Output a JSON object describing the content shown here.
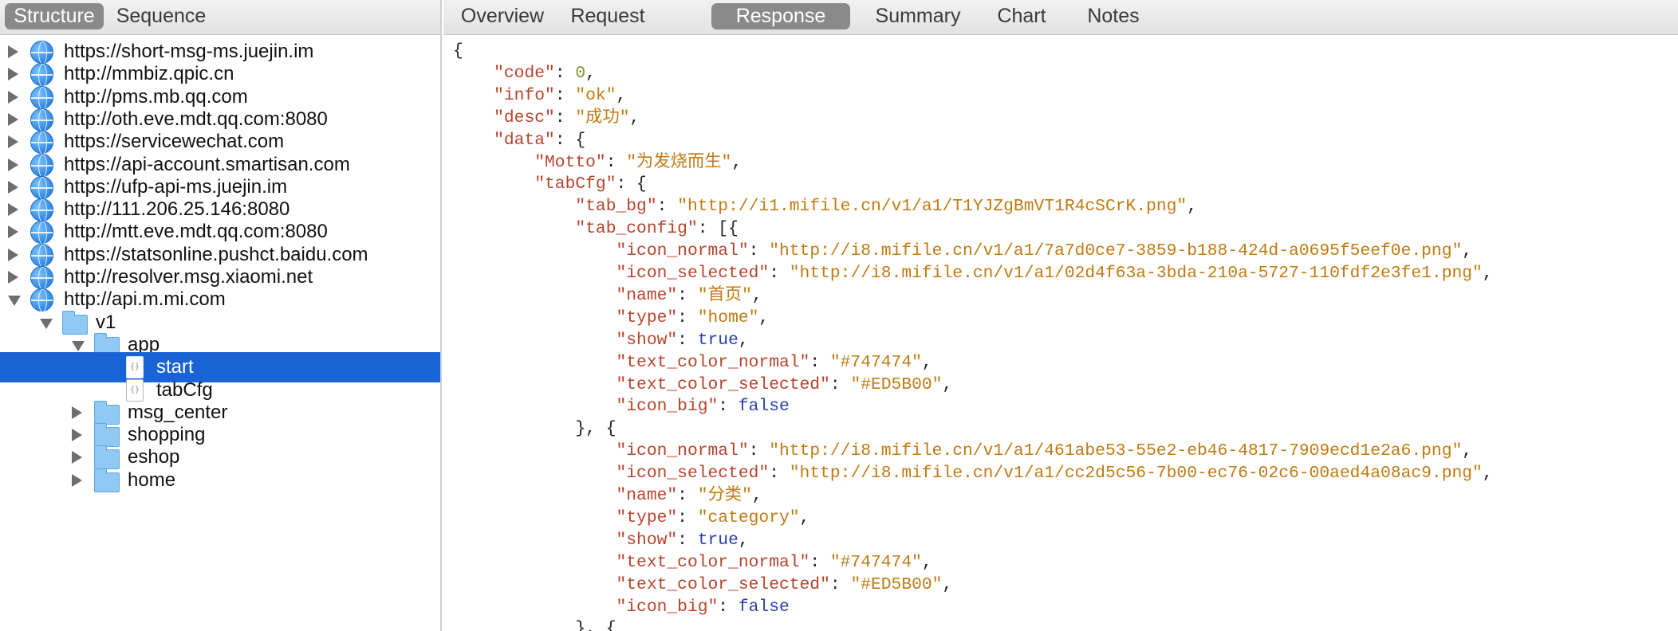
{
  "left_tabs": [
    {
      "label": "Structure",
      "active": true
    },
    {
      "label": "Sequence",
      "active": false
    }
  ],
  "right_tabs": [
    {
      "label": "Overview",
      "active": false
    },
    {
      "label": "Request",
      "active": false
    },
    {
      "label": "Response",
      "active": true
    },
    {
      "label": "Summary",
      "active": false
    },
    {
      "label": "Chart",
      "active": false
    },
    {
      "label": "Notes",
      "active": false
    }
  ],
  "tree": [
    {
      "label": "https://short-msg-ms.juejin.im",
      "icon": "globe-icon",
      "level": 0,
      "expanded": false
    },
    {
      "label": "http://mmbiz.qpic.cn",
      "icon": "globe-icon",
      "level": 0,
      "expanded": false
    },
    {
      "label": "http://pms.mb.qq.com",
      "icon": "globe-icon",
      "level": 0,
      "expanded": false
    },
    {
      "label": "http://oth.eve.mdt.qq.com:8080",
      "icon": "globe-icon",
      "level": 0,
      "expanded": false
    },
    {
      "label": "https://servicewechat.com",
      "icon": "globe-icon",
      "level": 0,
      "expanded": false
    },
    {
      "label": "https://api-account.smartisan.com",
      "icon": "globe-icon",
      "level": 0,
      "expanded": false
    },
    {
      "label": "https://ufp-api-ms.juejin.im",
      "icon": "globe-icon",
      "level": 0,
      "expanded": false
    },
    {
      "label": "http://111.206.25.146:8080",
      "icon": "globe-icon",
      "level": 0,
      "expanded": false
    },
    {
      "label": "http://mtt.eve.mdt.qq.com:8080",
      "icon": "globe-icon",
      "level": 0,
      "expanded": false
    },
    {
      "label": "https://statsonline.pushct.baidu.com",
      "icon": "globe-icon",
      "level": 0,
      "expanded": false
    },
    {
      "label": "http://resolver.msg.xiaomi.net",
      "icon": "globe-icon",
      "level": 0,
      "expanded": false
    },
    {
      "label": "http://api.m.mi.com",
      "icon": "globe-icon",
      "level": 0,
      "expanded": true
    },
    {
      "label": "v1",
      "icon": "folder-icon",
      "level": 1,
      "expanded": true
    },
    {
      "label": "app",
      "icon": "folder-icon",
      "level": 2,
      "expanded": true
    },
    {
      "label": "start",
      "icon": "json-file-icon",
      "level": 3,
      "leaf": true,
      "selected": true
    },
    {
      "label": "tabCfg",
      "icon": "json-file-icon",
      "level": 3,
      "leaf": true
    },
    {
      "label": "msg_center",
      "icon": "folder-icon",
      "level": 2,
      "expanded": false
    },
    {
      "label": "shopping",
      "icon": "folder-icon",
      "level": 2,
      "expanded": false
    },
    {
      "label": "eshop",
      "icon": "folder-icon",
      "level": 2,
      "expanded": false
    },
    {
      "label": "home",
      "icon": "folder-icon",
      "level": 2,
      "expanded": false
    }
  ],
  "response_lines": [
    [
      {
        "t": "p",
        "v": "{"
      }
    ],
    [
      {
        "t": "p",
        "v": "    "
      },
      {
        "t": "k",
        "v": "\"code\""
      },
      {
        "t": "p",
        "v": ": "
      },
      {
        "t": "n",
        "v": "0"
      },
      {
        "t": "p",
        "v": ","
      }
    ],
    [
      {
        "t": "p",
        "v": "    "
      },
      {
        "t": "k",
        "v": "\"info\""
      },
      {
        "t": "p",
        "v": ": "
      },
      {
        "t": "s",
        "v": "\"ok\""
      },
      {
        "t": "p",
        "v": ","
      }
    ],
    [
      {
        "t": "p",
        "v": "    "
      },
      {
        "t": "k",
        "v": "\"desc\""
      },
      {
        "t": "p",
        "v": ": "
      },
      {
        "t": "s",
        "v": "\"成功\""
      },
      {
        "t": "p",
        "v": ","
      }
    ],
    [
      {
        "t": "p",
        "v": "    "
      },
      {
        "t": "k",
        "v": "\"data\""
      },
      {
        "t": "p",
        "v": ": {"
      }
    ],
    [
      {
        "t": "p",
        "v": "        "
      },
      {
        "t": "k",
        "v": "\"Motto\""
      },
      {
        "t": "p",
        "v": ": "
      },
      {
        "t": "s",
        "v": "\"为发烧而生\""
      },
      {
        "t": "p",
        "v": ","
      }
    ],
    [
      {
        "t": "p",
        "v": "        "
      },
      {
        "t": "k",
        "v": "\"tabCfg\""
      },
      {
        "t": "p",
        "v": ": {"
      }
    ],
    [
      {
        "t": "p",
        "v": "            "
      },
      {
        "t": "k",
        "v": "\"tab_bg\""
      },
      {
        "t": "p",
        "v": ": "
      },
      {
        "t": "s",
        "v": "\"http://i1.mifile.cn/v1/a1/T1YJZgBmVT1R4cSCrK.png\""
      },
      {
        "t": "p",
        "v": ","
      }
    ],
    [
      {
        "t": "p",
        "v": "            "
      },
      {
        "t": "k",
        "v": "\"tab_config\""
      },
      {
        "t": "p",
        "v": ": [{"
      }
    ],
    [
      {
        "t": "p",
        "v": "                "
      },
      {
        "t": "k",
        "v": "\"icon_normal\""
      },
      {
        "t": "p",
        "v": ": "
      },
      {
        "t": "s",
        "v": "\"http://i8.mifile.cn/v1/a1/7a7d0ce7-3859-b188-424d-a0695f5eef0e.png\""
      },
      {
        "t": "p",
        "v": ","
      }
    ],
    [
      {
        "t": "p",
        "v": "                "
      },
      {
        "t": "k",
        "v": "\"icon_selected\""
      },
      {
        "t": "p",
        "v": ": "
      },
      {
        "t": "s",
        "v": "\"http://i8.mifile.cn/v1/a1/02d4f63a-3bda-210a-5727-110fdf2e3fe1.png\""
      },
      {
        "t": "p",
        "v": ","
      }
    ],
    [
      {
        "t": "p",
        "v": "                "
      },
      {
        "t": "k",
        "v": "\"name\""
      },
      {
        "t": "p",
        "v": ": "
      },
      {
        "t": "s",
        "v": "\"首页\""
      },
      {
        "t": "p",
        "v": ","
      }
    ],
    [
      {
        "t": "p",
        "v": "                "
      },
      {
        "t": "k",
        "v": "\"type\""
      },
      {
        "t": "p",
        "v": ": "
      },
      {
        "t": "s",
        "v": "\"home\""
      },
      {
        "t": "p",
        "v": ","
      }
    ],
    [
      {
        "t": "p",
        "v": "                "
      },
      {
        "t": "k",
        "v": "\"show\""
      },
      {
        "t": "p",
        "v": ": "
      },
      {
        "t": "b",
        "v": "true"
      },
      {
        "t": "p",
        "v": ","
      }
    ],
    [
      {
        "t": "p",
        "v": "                "
      },
      {
        "t": "k",
        "v": "\"text_color_normal\""
      },
      {
        "t": "p",
        "v": ": "
      },
      {
        "t": "s",
        "v": "\"#747474\""
      },
      {
        "t": "p",
        "v": ","
      }
    ],
    [
      {
        "t": "p",
        "v": "                "
      },
      {
        "t": "k",
        "v": "\"text_color_selected\""
      },
      {
        "t": "p",
        "v": ": "
      },
      {
        "t": "s",
        "v": "\"#ED5B00\""
      },
      {
        "t": "p",
        "v": ","
      }
    ],
    [
      {
        "t": "p",
        "v": "                "
      },
      {
        "t": "k",
        "v": "\"icon_big\""
      },
      {
        "t": "p",
        "v": ": "
      },
      {
        "t": "b",
        "v": "false"
      }
    ],
    [
      {
        "t": "p",
        "v": "            }, {"
      }
    ],
    [
      {
        "t": "p",
        "v": "                "
      },
      {
        "t": "k",
        "v": "\"icon_normal\""
      },
      {
        "t": "p",
        "v": ": "
      },
      {
        "t": "s",
        "v": "\"http://i8.mifile.cn/v1/a1/461abe53-55e2-eb46-4817-7909ecd1e2a6.png\""
      },
      {
        "t": "p",
        "v": ","
      }
    ],
    [
      {
        "t": "p",
        "v": "                "
      },
      {
        "t": "k",
        "v": "\"icon_selected\""
      },
      {
        "t": "p",
        "v": ": "
      },
      {
        "t": "s",
        "v": "\"http://i8.mifile.cn/v1/a1/cc2d5c56-7b00-ec76-02c6-00aed4a08ac9.png\""
      },
      {
        "t": "p",
        "v": ","
      }
    ],
    [
      {
        "t": "p",
        "v": "                "
      },
      {
        "t": "k",
        "v": "\"name\""
      },
      {
        "t": "p",
        "v": ": "
      },
      {
        "t": "s",
        "v": "\"分类\""
      },
      {
        "t": "p",
        "v": ","
      }
    ],
    [
      {
        "t": "p",
        "v": "                "
      },
      {
        "t": "k",
        "v": "\"type\""
      },
      {
        "t": "p",
        "v": ": "
      },
      {
        "t": "s",
        "v": "\"category\""
      },
      {
        "t": "p",
        "v": ","
      }
    ],
    [
      {
        "t": "p",
        "v": "                "
      },
      {
        "t": "k",
        "v": "\"show\""
      },
      {
        "t": "p",
        "v": ": "
      },
      {
        "t": "b",
        "v": "true"
      },
      {
        "t": "p",
        "v": ","
      }
    ],
    [
      {
        "t": "p",
        "v": "                "
      },
      {
        "t": "k",
        "v": "\"text_color_normal\""
      },
      {
        "t": "p",
        "v": ": "
      },
      {
        "t": "s",
        "v": "\"#747474\""
      },
      {
        "t": "p",
        "v": ","
      }
    ],
    [
      {
        "t": "p",
        "v": "                "
      },
      {
        "t": "k",
        "v": "\"text_color_selected\""
      },
      {
        "t": "p",
        "v": ": "
      },
      {
        "t": "s",
        "v": "\"#ED5B00\""
      },
      {
        "t": "p",
        "v": ","
      }
    ],
    [
      {
        "t": "p",
        "v": "                "
      },
      {
        "t": "k",
        "v": "\"icon_big\""
      },
      {
        "t": "p",
        "v": ": "
      },
      {
        "t": "b",
        "v": "false"
      }
    ],
    [
      {
        "t": "p",
        "v": "            }, {"
      }
    ]
  ],
  "colors": {
    "selection": "#1a63d6",
    "json_key": "#b7432c",
    "json_string": "#c07a12",
    "json_number": "#7a9b2a",
    "json_bool": "#2b3ea8"
  }
}
